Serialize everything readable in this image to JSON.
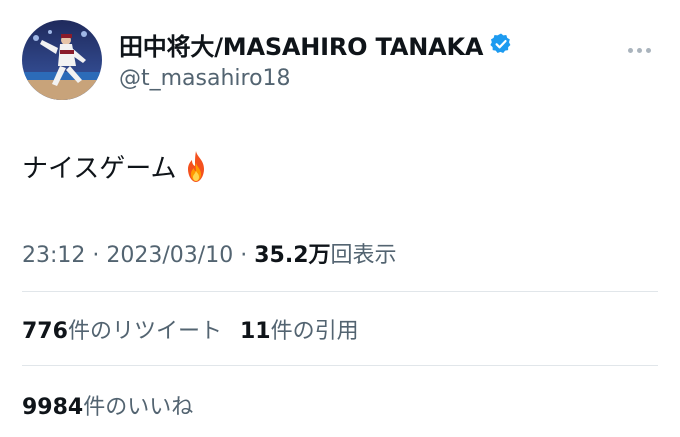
{
  "author": {
    "display_name": "田中将大/MASAHIRO TANAKA",
    "handle": "@t_masahiro18",
    "verified": true
  },
  "tweet": {
    "text": "ナイスゲーム",
    "emoji": "fire"
  },
  "meta": {
    "time": "23:12",
    "separator": "·",
    "date": "2023/03/10",
    "views_count": "35.2万",
    "views_label": "回表示"
  },
  "stats": {
    "retweets_count": "776",
    "retweets_label": "件のリツイート",
    "quotes_count": "11",
    "quotes_label": "件の引用",
    "likes_count": "9984",
    "likes_label": "件のいいね"
  },
  "colors": {
    "text_primary": "#0f1419",
    "text_secondary": "#536471",
    "verified_blue": "#1d9bf0",
    "divider": "#e1e6ea"
  },
  "icons": {
    "more": "more-horizontal-icon",
    "verified": "verified-badge-icon",
    "emoji": "fire-emoji-icon"
  }
}
